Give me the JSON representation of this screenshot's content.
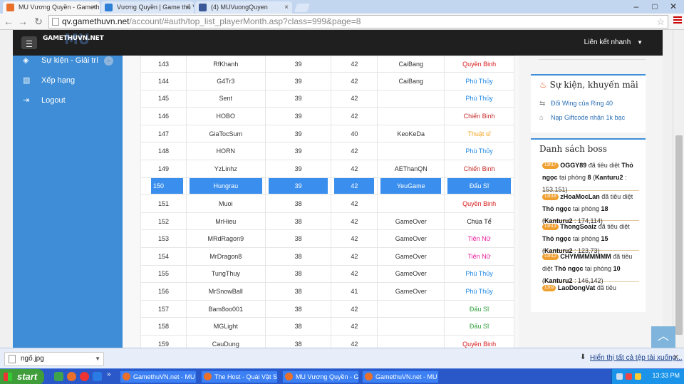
{
  "browser": {
    "tabs": [
      {
        "title": "MU Vương Quyền - Gamethu",
        "color": "#e8702a",
        "active": true
      },
      {
        "title": "Vương Quyền | Game thủ Vi",
        "color": "#2e7fd6",
        "active": false
      },
      {
        "title": "(4) MUVuongQuyen",
        "color": "#3b5998",
        "active": false
      }
    ],
    "url_host": "qv.gamethuvn.net",
    "url_path": "/account/#auth/top_list_playerMonth.asp?class=999&page=8"
  },
  "header": {
    "logo_text": "GAMETHUVN.NET",
    "logo_watermark": "MU",
    "quick_links_label": "Liên kết nhanh"
  },
  "sidebar": {
    "items": [
      {
        "label": "Sự kiện - Giải trí",
        "icon": "gamepad-icon",
        "badge": "-"
      },
      {
        "label": "Xếp hạng",
        "icon": "bar-chart-icon"
      },
      {
        "label": "Logout",
        "icon": "logout-icon"
      }
    ]
  },
  "ranking": {
    "highlight_rank": "150",
    "rows": [
      {
        "rank": "143",
        "name": "RfKhanh",
        "c1": "39",
        "c2": "42",
        "guild": "CaiBang",
        "class": "Quyền Binh",
        "color": "#d81b1b"
      },
      {
        "rank": "144",
        "name": "G4Tr3",
        "c1": "39",
        "c2": "42",
        "guild": "CaiBang",
        "class": "Phù Thủy",
        "color": "#1e88e5"
      },
      {
        "rank": "145",
        "name": "Sent",
        "c1": "39",
        "c2": "42",
        "guild": "",
        "class": "Phù Thủy",
        "color": "#1e88e5"
      },
      {
        "rank": "146",
        "name": "HOBO",
        "c1": "39",
        "c2": "42",
        "guild": "",
        "class": "Chiến Binh",
        "color": "#c62828"
      },
      {
        "rank": "147",
        "name": "GiaTocSum",
        "c1": "39",
        "c2": "40",
        "guild": "KeoKeDa",
        "class": "Thuật sĩ",
        "color": "#f5a623"
      },
      {
        "rank": "148",
        "name": "HORN",
        "c1": "39",
        "c2": "42",
        "guild": "",
        "class": "Phù Thủy",
        "color": "#1e88e5"
      },
      {
        "rank": "149",
        "name": "YzLinhz",
        "c1": "39",
        "c2": "42",
        "guild": "AEThanQN",
        "class": "Chiến Binh",
        "color": "#c62828"
      },
      {
        "rank": "150",
        "name": "Hungrau",
        "c1": "39",
        "c2": "42",
        "guild": "YeuGame",
        "class": "Đấu Sĩ",
        "color": "#ffffff"
      },
      {
        "rank": "151",
        "name": "Muoi",
        "c1": "38",
        "c2": "42",
        "guild": "",
        "class": "Quyền Binh",
        "color": "#d81b1b"
      },
      {
        "rank": "152",
        "name": "MrHieu",
        "c1": "38",
        "c2": "42",
        "guild": "GameOver",
        "class": "Chúa Tể",
        "color": "#222222"
      },
      {
        "rank": "153",
        "name": "MRdRagon9",
        "c1": "38",
        "c2": "42",
        "guild": "GameOver",
        "class": "Tiên Nữ",
        "color": "#e91e9c"
      },
      {
        "rank": "154",
        "name": "MrDragon8",
        "c1": "38",
        "c2": "42",
        "guild": "GameOver",
        "class": "Tiên Nữ",
        "color": "#e91e9c"
      },
      {
        "rank": "155",
        "name": "TungThuy",
        "c1": "38",
        "c2": "42",
        "guild": "GameOver",
        "class": "Phù Thủy",
        "color": "#1e88e5"
      },
      {
        "rank": "156",
        "name": "MrSnowBall",
        "c1": "38",
        "c2": "41",
        "guild": "GameOver",
        "class": "Phù Thủy",
        "color": "#1e88e5"
      },
      {
        "rank": "157",
        "name": "Bam8oo001",
        "c1": "38",
        "c2": "42",
        "guild": "",
        "class": "Đấu Sĩ",
        "color": "#2e9d3a"
      },
      {
        "rank": "158",
        "name": "MGLight",
        "c1": "38",
        "c2": "42",
        "guild": "",
        "class": "Đấu Sĩ",
        "color": "#2e9d3a"
      },
      {
        "rank": "159",
        "name": "CauDung",
        "c1": "38",
        "c2": "42",
        "guild": "",
        "class": "Quyền Binh",
        "color": "#d81b1b"
      }
    ]
  },
  "events_panel": {
    "title": "Sự kiện, khuyến mãi",
    "links": [
      {
        "label": "Đổi Wing của Ring 40",
        "icon": "exchange-icon"
      },
      {
        "label": "Nạp Giftcode nhận 1k bạc",
        "icon": "gift-icon"
      }
    ]
  },
  "boss_panel": {
    "title": "Danh sách boss",
    "entries": [
      {
        "time": "13h17",
        "player": "OGGY89",
        "text_a": " đã tiêu diệt ",
        "boss": "Thỏ ngọc",
        "text_b": " tại phòng ",
        "room": "8",
        "map": "Kanturu2",
        "coords": "153,151"
      },
      {
        "time": "13h16",
        "player": "zHoaMocLan",
        "text_a": " đã tiêu diệt ",
        "boss": "Thỏ ngọc",
        "text_b": " tại phòng ",
        "room": "18",
        "map": "Kanturu2",
        "coords": "174,114"
      },
      {
        "time": "13h13",
        "player": "ThongSoaiz",
        "text_a": " đã tiêu diệt ",
        "boss": "Thỏ ngọc",
        "text_b": " tại phòng ",
        "room": "15",
        "map": "Kanturu2",
        "coords": "123,73"
      },
      {
        "time": "13h12",
        "player": "CHYMMMMMMM",
        "text_a": " đã tiêu diệt ",
        "boss": "Thỏ ngọc",
        "text_b": " tại phòng ",
        "room": "10",
        "map": "Kanturu2",
        "coords": "146,142"
      },
      {
        "time": "13h9",
        "player": "LaoDongVat",
        "text_a": " đã tiêu",
        "boss": "",
        "text_b": "",
        "room": "",
        "map": "",
        "coords": ""
      }
    ]
  },
  "downloads": {
    "file_name": "ngố.jpg",
    "show_all_label": "Hiển thị tất cả tệp tải xuống..."
  },
  "taskbar": {
    "start_label": "start",
    "buttons": [
      {
        "label": "GamethuVN.net - MU ...",
        "color": "#e8702a"
      },
      {
        "label": "The Host - Quái Vật S...",
        "color": "#e8702a"
      },
      {
        "label": "MU Vương Quyền - G...",
        "color": "#e8702a"
      },
      {
        "label": "GamethuVN.net - MU ...",
        "color": "#e8702a"
      }
    ],
    "clock": "13:33 PM"
  }
}
